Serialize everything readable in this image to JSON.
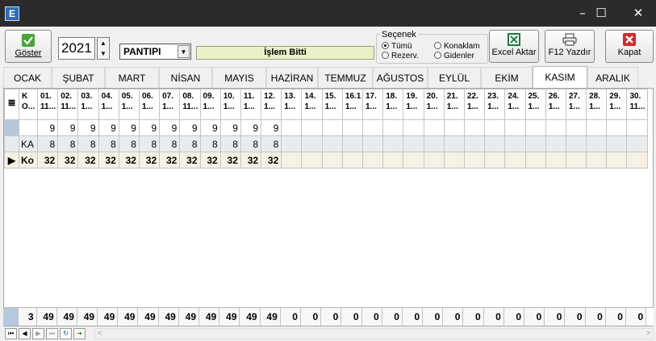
{
  "window": {
    "app_icon_letter": "E",
    "minimize": "–",
    "maximize": "☐",
    "close": "✕"
  },
  "toolbar": {
    "show_label": "Göster",
    "year": "2021",
    "type_select": "PANTIPI",
    "status": "İşlem Bitti",
    "options_title": "Seçenek",
    "options": [
      "Tümü",
      "Rezerv.",
      "Konaklam",
      "Gidenler"
    ],
    "options_selected": "Tümü",
    "excel_label": "Excel Aktar",
    "print_label": "F12 Yazdır",
    "close_label": "Kapat",
    "colors": {
      "excel": "#1f7a3e",
      "close": "#d8262b",
      "show_check": "#4aa43a"
    }
  },
  "tabs": [
    "OCAK",
    "ŞUBAT",
    "MART",
    "NİSAN",
    "MAYIS",
    "HAZİRAN",
    "TEMMUZ",
    "AĞUSTOS",
    "EYLÜL",
    "EKİM",
    "KASIM",
    "ARALIK"
  ],
  "active_tab": "KASIM",
  "grid": {
    "first_header": [
      "K",
      "O..."
    ],
    "day_headers": [
      [
        "01.",
        "11..."
      ],
      [
        "02.",
        "11..."
      ],
      [
        "03.",
        "1..."
      ],
      [
        "04.",
        "1..."
      ],
      [
        "05.",
        "1..."
      ],
      [
        "06.",
        "1..."
      ],
      [
        "07.",
        "1..."
      ],
      [
        "08.",
        "11..."
      ],
      [
        "09.",
        "1..."
      ],
      [
        "10.",
        "1..."
      ],
      [
        "11.",
        "1..."
      ],
      [
        "12.",
        "1..."
      ],
      [
        "13.",
        "1..."
      ],
      [
        "14.",
        "1..."
      ],
      [
        "15.",
        "1..."
      ],
      [
        "16.1",
        "1..."
      ],
      [
        "17.",
        "1..."
      ],
      [
        "18.",
        "1..."
      ],
      [
        "19.",
        "1..."
      ],
      [
        "20.",
        "1..."
      ],
      [
        "21.",
        "1..."
      ],
      [
        "22.",
        "1..."
      ],
      [
        "23.",
        "1..."
      ],
      [
        "24.",
        "1..."
      ],
      [
        "25.",
        "1..."
      ],
      [
        "26.",
        "1..."
      ],
      [
        "27.",
        "1..."
      ],
      [
        "28.",
        "1..."
      ],
      [
        "29.",
        "1..."
      ],
      [
        "30.",
        "11..."
      ]
    ],
    "rows": [
      {
        "label": "",
        "values": [
          "9",
          "9",
          "9",
          "9",
          "9",
          "9",
          "9",
          "9",
          "9",
          "9",
          "9",
          "9",
          "",
          "",
          "",
          "",
          "",
          "",
          "",
          "",
          "",
          "",
          "",
          "",
          "",
          "",
          "",
          "",
          "",
          ""
        ]
      },
      {
        "label": "KA",
        "values": [
          "8",
          "8",
          "8",
          "8",
          "8",
          "8",
          "8",
          "8",
          "8",
          "8",
          "8",
          "8",
          "",
          "",
          "",
          "",
          "",
          "",
          "",
          "",
          "",
          "",
          "",
          "",
          "",
          "",
          "",
          "",
          "",
          ""
        ]
      },
      {
        "label": "Ko",
        "values": [
          "32",
          "32",
          "32",
          "32",
          "32",
          "32",
          "32",
          "32",
          "32",
          "32",
          "32",
          "32",
          "",
          "",
          "",
          "",
          "",
          "",
          "",
          "",
          "",
          "",
          "",
          "",
          "",
          "",
          "",
          "",
          "",
          ""
        ]
      }
    ],
    "current_row_marker": "▶",
    "totals_first": "3",
    "totals": [
      "49",
      "49",
      "49",
      "49",
      "49",
      "49",
      "49",
      "49",
      "49",
      "49",
      "49",
      "49",
      "0",
      "0",
      "0",
      "0",
      "0",
      "0",
      "0",
      "0",
      "0",
      "0",
      "0",
      "0",
      "0",
      "0",
      "0",
      "0",
      "0",
      "0"
    ]
  },
  "navigator": {
    "first": "⏮",
    "prev": "◀",
    "next": "▶",
    "last": "⏭",
    "refresh": "↻",
    "export": "➜"
  }
}
